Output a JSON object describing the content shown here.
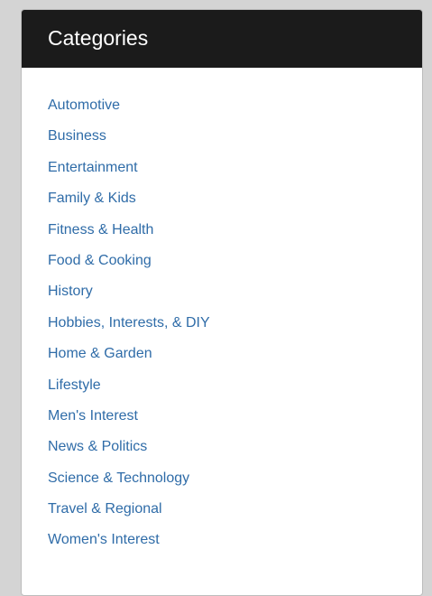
{
  "panel": {
    "title": "Categories",
    "categories": [
      "Automotive",
      "Business",
      "Entertainment",
      "Family & Kids",
      "Fitness & Health",
      "Food & Cooking",
      "History",
      "Hobbies, Interests, & DIY",
      "Home & Garden",
      "Lifestyle",
      "Men's Interest",
      "News & Politics",
      "Science & Technology",
      "Travel & Regional",
      "Women's Interest"
    ]
  },
  "colors": {
    "header_background": "#1b1b1b",
    "header_text": "#ffffff",
    "link": "#2f6ca8",
    "page_background": "#d4d4d4"
  }
}
